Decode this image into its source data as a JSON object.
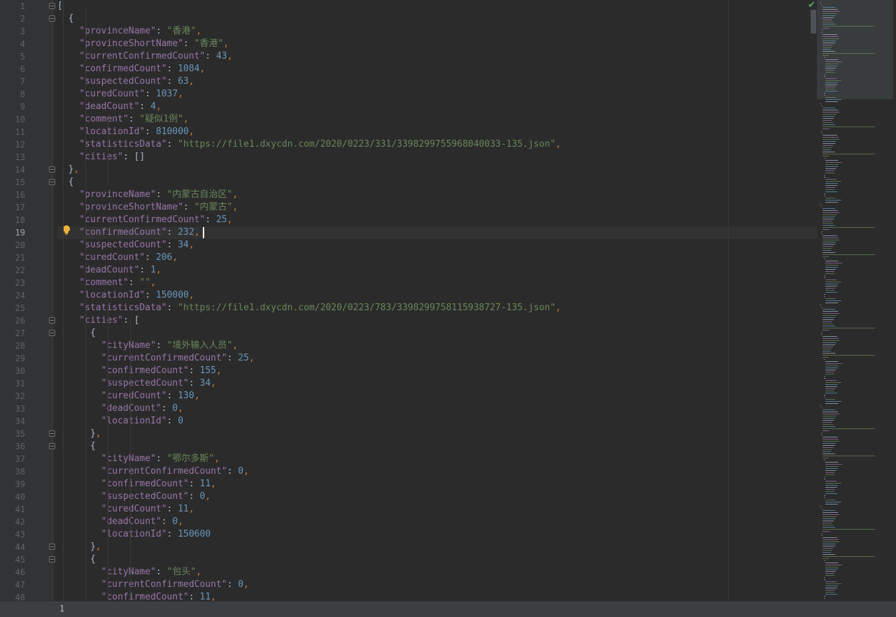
{
  "editor": {
    "current_line": 19,
    "first_line_number": 1,
    "lines": [
      "[",
      "  {",
      "    \"provinceName\": \"香港\",",
      "    \"provinceShortName\": \"香港\",",
      "    \"currentConfirmedCount\": 43,",
      "    \"confirmedCount\": 1084,",
      "    \"suspectedCount\": 63,",
      "    \"curedCount\": 1037,",
      "    \"deadCount\": 4,",
      "    \"comment\": \"疑似1例\",",
      "    \"locationId\": 810000,",
      "    \"statisticsData\": \"https://file1.dxycdn.com/2020/0223/331/3398299755968040033-135.json\",",
      "    \"cities\": []",
      "  },",
      "  {",
      "    \"provinceName\": \"内蒙古自治区\",",
      "    \"provinceShortName\": \"内蒙古\",",
      "    \"currentConfirmedCount\": 25,",
      "    \"confirmedCount\": 232,",
      "    \"suspectedCount\": 34,",
      "    \"curedCount\": 206,",
      "    \"deadCount\": 1,",
      "    \"comment\": \"\",",
      "    \"locationId\": 150000,",
      "    \"statisticsData\": \"https://file1.dxycdn.com/2020/0223/783/3398299758115938727-135.json\",",
      "    \"cities\": [",
      "      {",
      "        \"cityName\": \"境外输入人员\",",
      "        \"currentConfirmedCount\": 25,",
      "        \"confirmedCount\": 155,",
      "        \"suspectedCount\": 34,",
      "        \"curedCount\": 130,",
      "        \"deadCount\": 0,",
      "        \"locationId\": 0",
      "      },",
      "      {",
      "        \"cityName\": \"鄂尔多斯\",",
      "        \"currentConfirmedCount\": 0,",
      "        \"confirmedCount\": 11,",
      "        \"suspectedCount\": 0,",
      "        \"curedCount\": 11,",
      "        \"deadCount\": 0,",
      "        \"locationId\": 150600",
      "      },",
      "      {",
      "        \"cityName\": \"包头\",",
      "        \"currentConfirmedCount\": 0,",
      "        \"confirmedCount\": 11,"
    ]
  },
  "bottom_bar": {
    "text": "1"
  },
  "icons": {
    "fold_marker": "fold-icon",
    "intention_bulb": "lightbulb-icon",
    "inspection_ok": "checkmark-icon"
  },
  "colors": {
    "background": "#2b2b2b",
    "key": "#9876aa",
    "string": "#6a8759",
    "number": "#6897bb",
    "punctuation": "#cc7832",
    "text": "#a9b7c6",
    "gutter": "#313335",
    "line_number": "#606366"
  }
}
